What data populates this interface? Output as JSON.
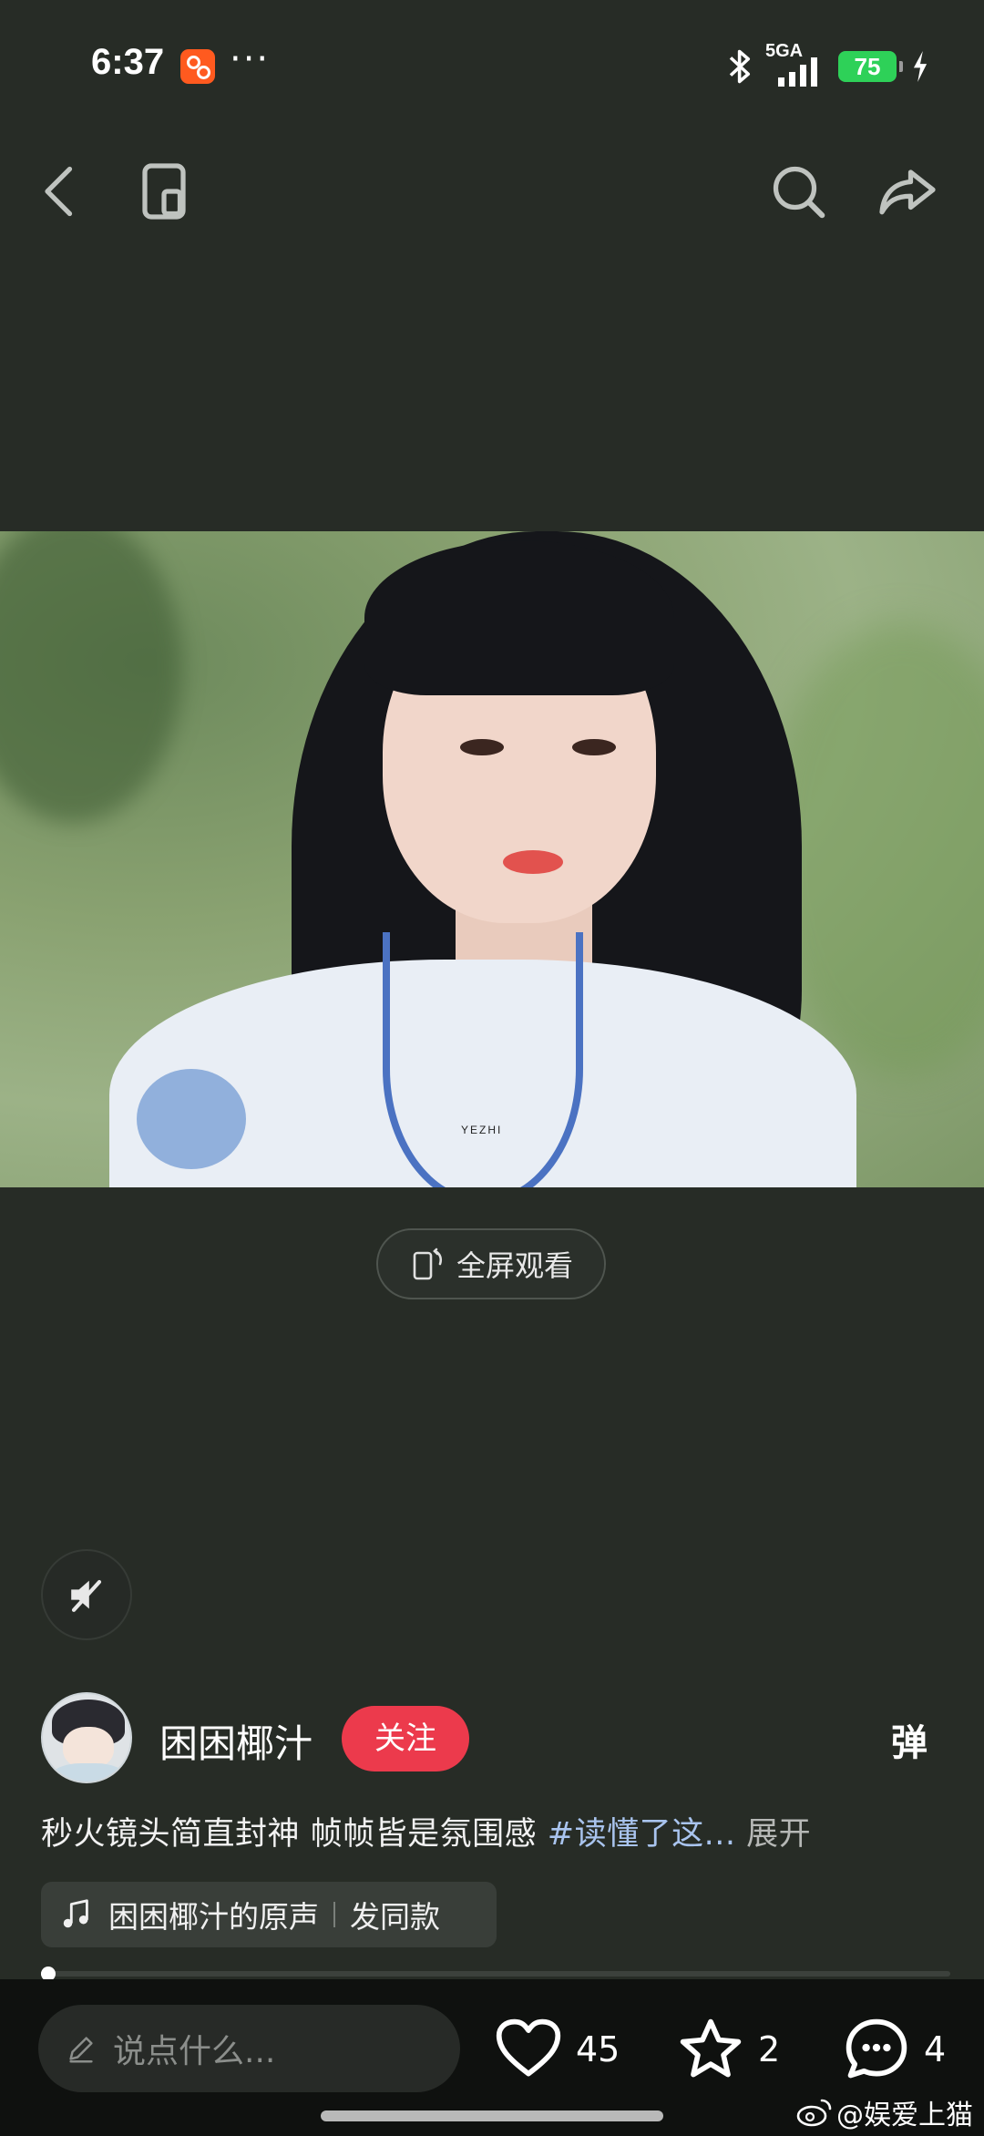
{
  "status_bar": {
    "time": "6:37",
    "dots": "···",
    "network": "5GA",
    "battery": "75"
  },
  "video": {
    "watermark": "YEZHI"
  },
  "fullscreen_label": "全屏观看",
  "author": {
    "name": "困困椰汁",
    "follow_label": "关注"
  },
  "danmaku_label": "弹",
  "caption": {
    "text": "秒火镜头简直封神  帧帧皆是氛围感 ",
    "hashtag": "#读懂了这...",
    "expand": "展开"
  },
  "music": {
    "title": "困困椰汁的原声",
    "action": "发同款"
  },
  "progress": {
    "fraction": 0.005
  },
  "bottom_bar": {
    "comment_placeholder": "说点什么...",
    "likes": "45",
    "favorites": "2",
    "comments": "4",
    "watermark": "@娱爱上猫"
  },
  "colors": {
    "background": "#272c26",
    "follow": "#ec3a4c",
    "hashtag": "#a9c4ee",
    "battery": "#2ed158"
  }
}
